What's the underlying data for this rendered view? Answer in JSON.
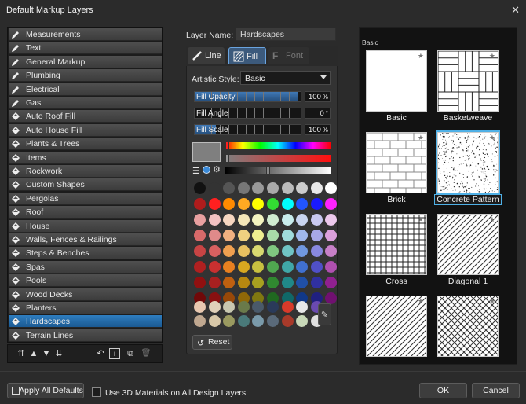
{
  "window": {
    "title": "Default Markup Layers",
    "close": "✕"
  },
  "layers": [
    {
      "label": "Measurements",
      "icon": "pencil-icon",
      "selected": false
    },
    {
      "label": "Text",
      "icon": "pencil-icon",
      "selected": false
    },
    {
      "label": "General Markup",
      "icon": "pencil-icon",
      "selected": false
    },
    {
      "label": "Plumbing",
      "icon": "pencil-icon",
      "selected": false
    },
    {
      "label": "Electrical",
      "icon": "pencil-icon",
      "selected": false
    },
    {
      "label": "Gas",
      "icon": "pencil-icon",
      "selected": false
    },
    {
      "label": "Auto Roof Fill",
      "icon": "fill-bucket-icon",
      "selected": false
    },
    {
      "label": "Auto House Fill",
      "icon": "fill-bucket-icon",
      "selected": false
    },
    {
      "label": "Plants & Trees",
      "icon": "fill-bucket-icon",
      "selected": false
    },
    {
      "label": "Items",
      "icon": "fill-bucket-icon",
      "selected": false
    },
    {
      "label": "Rockwork",
      "icon": "fill-bucket-icon",
      "selected": false
    },
    {
      "label": "Custom Shapes",
      "icon": "fill-bucket-icon",
      "selected": false
    },
    {
      "label": "Pergolas",
      "icon": "fill-bucket-icon",
      "selected": false
    },
    {
      "label": "Roof",
      "icon": "fill-bucket-icon",
      "selected": false
    },
    {
      "label": "House",
      "icon": "fill-bucket-icon",
      "selected": false
    },
    {
      "label": "Walls, Fences & Railings",
      "icon": "fill-bucket-icon",
      "selected": false
    },
    {
      "label": "Steps & Benches",
      "icon": "fill-bucket-icon",
      "selected": false
    },
    {
      "label": "Spas",
      "icon": "fill-bucket-icon",
      "selected": false
    },
    {
      "label": "Pools",
      "icon": "fill-bucket-icon",
      "selected": false
    },
    {
      "label": "Wood Decks",
      "icon": "fill-bucket-icon",
      "selected": false
    },
    {
      "label": "Planters",
      "icon": "fill-bucket-icon",
      "selected": false
    },
    {
      "label": "Hardscapes",
      "icon": "fill-bucket-icon",
      "selected": true
    },
    {
      "label": "Terrain Lines",
      "icon": "fill-bucket-icon",
      "selected": false
    }
  ],
  "listbar": {
    "move_top": "⇈",
    "move_up": "▲",
    "move_down": "▼",
    "move_bottom": "⇊",
    "undo": "↶",
    "add": "+",
    "duplicate": "⧉",
    "delete": "🗑"
  },
  "layer_name": {
    "label": "Layer Name:",
    "value": "Hardscapes"
  },
  "tabs": [
    {
      "label": "Line"
    },
    {
      "label": "Fill"
    },
    {
      "label": "Font"
    }
  ],
  "artistic_style": {
    "label": "Artistic Style:",
    "value": "Basic"
  },
  "sliders": [
    {
      "label": "Fill Opacity",
      "value": "100",
      "unit": "%",
      "fraction": 0.97
    },
    {
      "label": "Fill Angle",
      "value": "0",
      "unit": "°",
      "fraction": 0.0
    },
    {
      "label": "Fill Scale",
      "value": "100",
      "unit": "%",
      "fraction": 0.2
    }
  ],
  "color": {
    "current": "#7f7f7f"
  },
  "palette": [
    [
      "#111111",
      "#333333",
      "#555555",
      "#777777",
      "#999999",
      "#aaaaaa",
      "#bbbbbb",
      "#cccccc",
      "#e8e8e8",
      "#ffffff"
    ],
    [
      "#b01c1c",
      "#ff2020",
      "#ff8a00",
      "#ffaa22",
      "#ffff00",
      "#33dd33",
      "#00ffff",
      "#2255ff",
      "#1a1aff",
      "#ff22ff"
    ],
    [
      "#e8a0a0",
      "#f2c2c2",
      "#f6d6c0",
      "#f4e6b8",
      "#f4f4c0",
      "#d0ecd0",
      "#c8ecec",
      "#c8d4f0",
      "#c8c8f0",
      "#ecc8ec"
    ],
    [
      "#d86a6a",
      "#e08a8a",
      "#f0b080",
      "#f0d080",
      "#eeee90",
      "#a8dca8",
      "#a0dcdc",
      "#a0b8ec",
      "#a8a8e8",
      "#dca0dc"
    ],
    [
      "#c84444",
      "#d86060",
      "#f0a050",
      "#e8c060",
      "#d8d870",
      "#80c880",
      "#70c4c4",
      "#7098e0",
      "#8888e0",
      "#c880c8"
    ],
    [
      "#b02020",
      "#c83030",
      "#e88020",
      "#d8a820",
      "#c8c040",
      "#50a850",
      "#40a8a8",
      "#4070d0",
      "#5050c8",
      "#b050b0"
    ],
    [
      "#901010",
      "#a82020",
      "#c06010",
      "#b88810",
      "#a8a020",
      "#308830",
      "#208888",
      "#2050a8",
      "#3030a0",
      "#902090"
    ],
    [
      "#700808",
      "#881010",
      "#984808",
      "#906808",
      "#807810",
      "#206820",
      "#106868",
      "#103888",
      "#202080",
      "#701070"
    ]
  ],
  "recent": [
    [
      "#e8c8b0",
      "#e0d0b8",
      "#c8c8b0",
      "#6a7a4a",
      "#4a5a6a",
      "#2a3a5a",
      "#d83a2a",
      "#e8e8e8",
      "#6a4ab0"
    ],
    [
      "#c0a890",
      "#d8c8a8",
      "#9a9a60",
      "#4a7a7a",
      "#7a9aaa",
      "#5a6a7a",
      "#a83a2a",
      "#c8d8b8",
      "#e0e0e0"
    ]
  ],
  "reset_label": "Reset",
  "gallery": {
    "header": "Basic",
    "items": [
      {
        "label": "Basic",
        "pattern": "basic"
      },
      {
        "label": "Basketweave",
        "pattern": "basketweave"
      },
      {
        "label": "Brick",
        "pattern": "brick"
      },
      {
        "label": "Concrete Pattern",
        "pattern": "concrete",
        "selected": true
      },
      {
        "label": "Cross",
        "pattern": "cross"
      },
      {
        "label": "Diagonal 1",
        "pattern": "diagonal1"
      },
      {
        "label": "",
        "pattern": "diagonal2"
      },
      {
        "label": "",
        "pattern": "diagonal3"
      }
    ]
  },
  "bottom": {
    "apply_all": "Apply All Defaults",
    "use_3d": "Use 3D Materials on All Design Layers",
    "ok": "OK",
    "cancel": "Cancel"
  }
}
